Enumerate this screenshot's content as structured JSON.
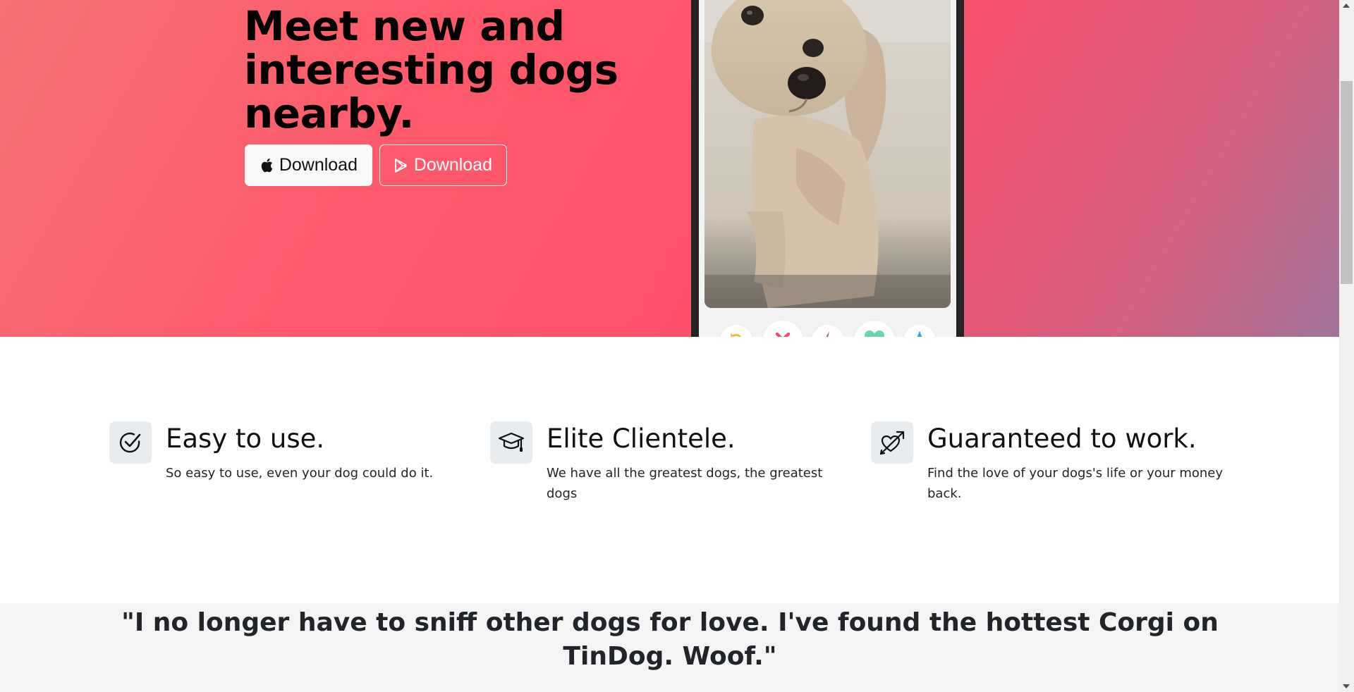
{
  "hero": {
    "title": "Meet new and interesting dogs nearby.",
    "buttons": [
      {
        "label": "Download",
        "icon": "apple-icon",
        "style": "light"
      },
      {
        "label": "Download",
        "icon": "google-play-icon",
        "style": "outline-light"
      }
    ],
    "gradient_colors": [
      "#f47272",
      "#ff4f6b",
      "#a2749c"
    ]
  },
  "phone": {
    "actions": [
      {
        "icon": "rewind-icon",
        "color": "#f5b748"
      },
      {
        "icon": "nope-x-icon",
        "color": "#f0506e"
      },
      {
        "icon": "boost-bolt-icon",
        "color": "#9b59b6"
      },
      {
        "icon": "like-heart-icon",
        "color": "#6bd3b1"
      },
      {
        "icon": "super-like-star-icon",
        "color": "#3fa9f5"
      }
    ]
  },
  "features": [
    {
      "icon": "check-circle-icon",
      "title": "Easy to use.",
      "text": "So easy to use, even your dog could do it."
    },
    {
      "icon": "graduation-cap-icon",
      "title": "Elite Clientele.",
      "text": "We have all the greatest dogs, the greatest dogs"
    },
    {
      "icon": "heart-arrow-icon",
      "title": "Guaranteed to work.",
      "text": "Find the love of your dogs's life or your money back."
    }
  ],
  "testimonial": {
    "quote": "\"I no longer have to sniff other dogs for love. I've found the hottest Corgi on TinDog. Woof.\""
  }
}
